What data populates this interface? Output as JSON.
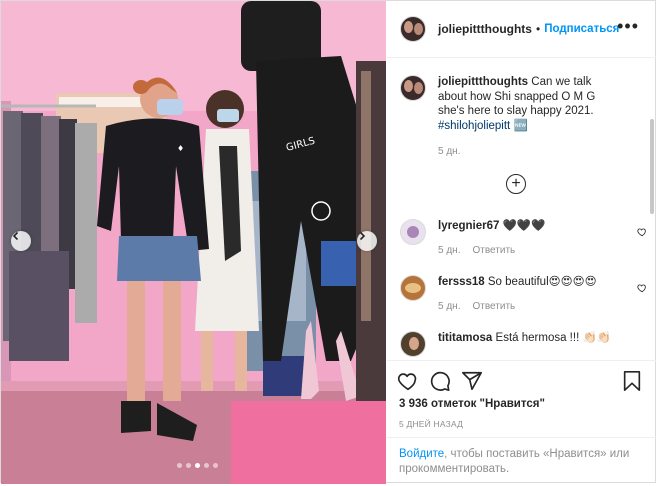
{
  "header": {
    "username": "joliepittthoughts",
    "separator": "•",
    "follow_label": "Подписаться",
    "more_label": "•••"
  },
  "caption": {
    "username": "joliepittthoughts",
    "text": "Can we talk about how Shi snapped O M G she's here to slay happy 2021.",
    "hashtag": "#shilohjoliepitt",
    "emoji": "🆕",
    "age": "5 дн."
  },
  "load_more_label": "+",
  "comments": [
    {
      "username": "lyregnier67",
      "text": "🖤🖤🖤",
      "age": "5 дн.",
      "reply_label": "Ответить"
    },
    {
      "username": "fersss18",
      "text": "So beautiful😍😍😍😍",
      "age": "5 дн.",
      "reply_label": "Ответить"
    },
    {
      "username": "tititamosa",
      "text": "Está hermosa !!! 👏🏻👏🏻",
      "age": "",
      "reply_label": ""
    }
  ],
  "icons": {
    "like": "heart-icon",
    "comment": "comment-icon",
    "share": "share-icon",
    "save": "bookmark-icon",
    "prev": "chevron-left-icon",
    "next": "chevron-right-icon"
  },
  "likes_text": "3 936 отметок \"Нравится\"",
  "timestamp": "5 ДНЕЙ НАЗАД",
  "login_prompt": {
    "link": "Войдите",
    "rest": ", чтобы поставить «Нравится» или прокомментировать."
  },
  "carousel": {
    "slide_count": 5,
    "active_slide": 3
  },
  "colors": {
    "accent": "#0095f6",
    "hashtag": "#00376b",
    "muted": "#8e8e8e"
  }
}
